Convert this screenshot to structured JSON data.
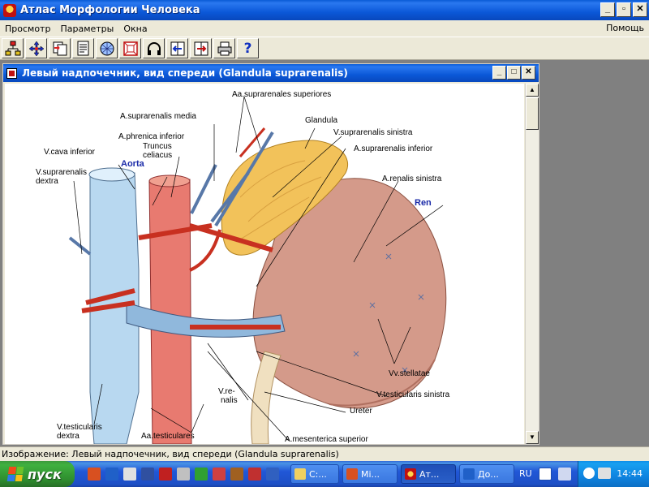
{
  "app": {
    "title": "Атлас Морфологии Человека",
    "min_label": "_",
    "max_label": "▫",
    "close_label": "✕"
  },
  "menu": {
    "items": [
      "Просмотр",
      "Параметры",
      "Окна"
    ],
    "help": "Помощь"
  },
  "toolbar": {
    "buttons": [
      "tree-icon",
      "move-icon",
      "copy-icon",
      "document-icon",
      "globe-icon",
      "zoom-box-icon",
      "headphones-icon",
      "back-panel-icon",
      "forward-panel-icon",
      "print-icon",
      "help-icon"
    ],
    "help_glyph": "?"
  },
  "child": {
    "title": "Левый надпочечник, вид спереди (Glandula suprarenalis)",
    "min_label": "_",
    "max_label": "□",
    "close_label": "✕"
  },
  "labels": {
    "aa_suprarenales_superiores": "Aa.suprarenales superiores",
    "a_suprarenalis_media": "A.suprarenalis media",
    "glandula": "Glandula",
    "v_suprarenalis_sinistra": "V.suprarenalis sinistra",
    "a_phrenica_inferior": "A.phrenica inferior",
    "a_suprarenalis_inferior": "A.suprarenalis inferior",
    "truncus": "Truncus",
    "celiacus": "celiacus",
    "v_cava_inferior": "V.cava inferior",
    "aorta": "Aorta",
    "v_suprarenalis": "V.suprarenalis",
    "dextra": "dextra",
    "a_renalis_sinistra": "A.renalis sinistra",
    "ren": "Ren",
    "vv_stellatae": "Vv.stellatae",
    "v_re": "V.re-",
    "nalis": "nalis",
    "v_testicularis_sinistra": "V.testicularis sinistra",
    "ureter": "Ureter",
    "v_testicularis": "V.testicularis",
    "dextra2": "dextra",
    "aa_testiculares": "Aa.testiculares",
    "a_mesenterica_superior": "A.mesenterica superior"
  },
  "status": {
    "text": "Изображение: Левый надпочечник, вид спереди (Glandula suprarenalis)"
  },
  "taskbar": {
    "start_label": "пуск",
    "tasks": [
      {
        "label": "C:...",
        "icon": "folder-icon"
      },
      {
        "label": "Mi...",
        "icon": "powerpoint-icon"
      },
      {
        "label": "Ат...",
        "icon": "atlas-icon"
      },
      {
        "label": "До...",
        "icon": "word-icon"
      }
    ],
    "lang": "RU",
    "clock": "14:44"
  },
  "colors": {
    "xp_blue": "#0b58d8",
    "face": "#ece9d8",
    "mdi": "#808080",
    "label_blue": "#1a2aa8"
  }
}
